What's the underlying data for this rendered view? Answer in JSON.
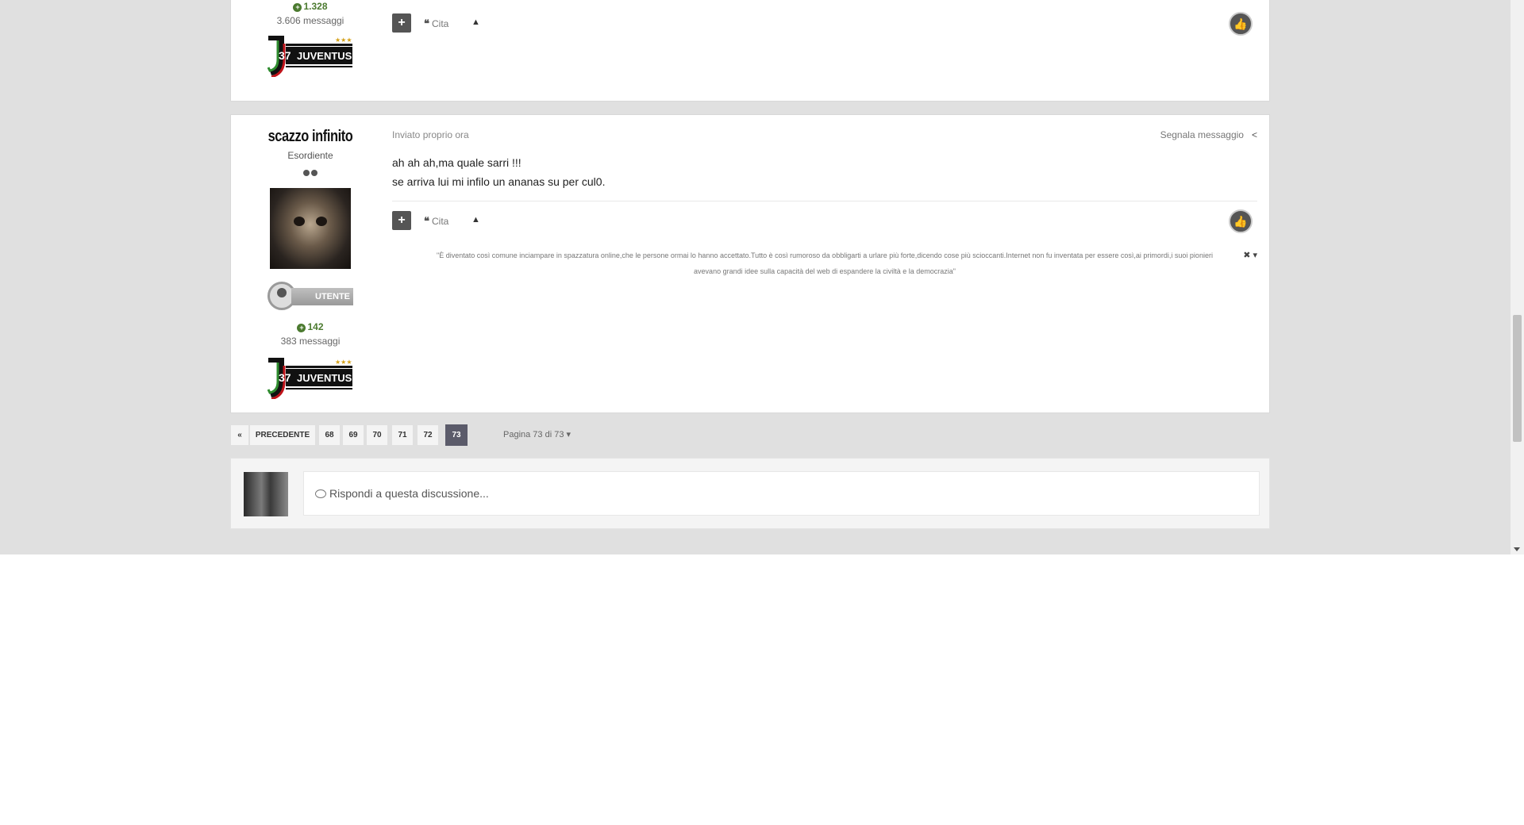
{
  "post_prev": {
    "reputation": "1.328",
    "messages": "3.606 messaggi",
    "badge": {
      "number": "37",
      "team": "JUVENTUS",
      "stars": "★★★"
    },
    "controls": {
      "multiquote": "+",
      "quote": "Cita",
      "arrow": "▲"
    }
  },
  "post": {
    "username": "scazzo infinito",
    "rank": "Esordiente",
    "group": "UTENTE",
    "reputation": "142",
    "messages": "383 messaggi",
    "badge": {
      "number": "37",
      "team": "JUVENTUS",
      "stars": "★★★"
    },
    "meta": "Inviato proprio ora",
    "report": "Segnala messaggio",
    "content": [
      "ah ah ah,ma quale sarri !!!",
      "se arriva lui mi infilo un ananas su per cul0."
    ],
    "controls": {
      "multiquote": "+",
      "quote": "Cita",
      "arrow": "▲"
    },
    "signature": [
      "\"È diventato così comune inciampare in spazzatura online,che le persone ormai lo hanno accettato.Tutto è così rumoroso da obbligarti a urlare più forte,dicendo cose più scioccanti.Internet non fu inventata per essere così,ai primordi,i suoi pionieri",
      "avevano grandi idee sulla capacità del web di espandere la civiltà e la democrazia\""
    ]
  },
  "pagination": {
    "first": "«",
    "prev": "PRECEDENTE",
    "pages": [
      "68",
      "69",
      "70",
      "71",
      "72",
      "73"
    ],
    "current": "73",
    "page_of": "Pagina 73 di 73"
  },
  "reply": {
    "placeholder": "Rispondi a questa discussione..."
  },
  "colors": {
    "background": "#e0e0e0",
    "reputation": "#4b7a2f",
    "active_page": "#5b5b6a"
  }
}
